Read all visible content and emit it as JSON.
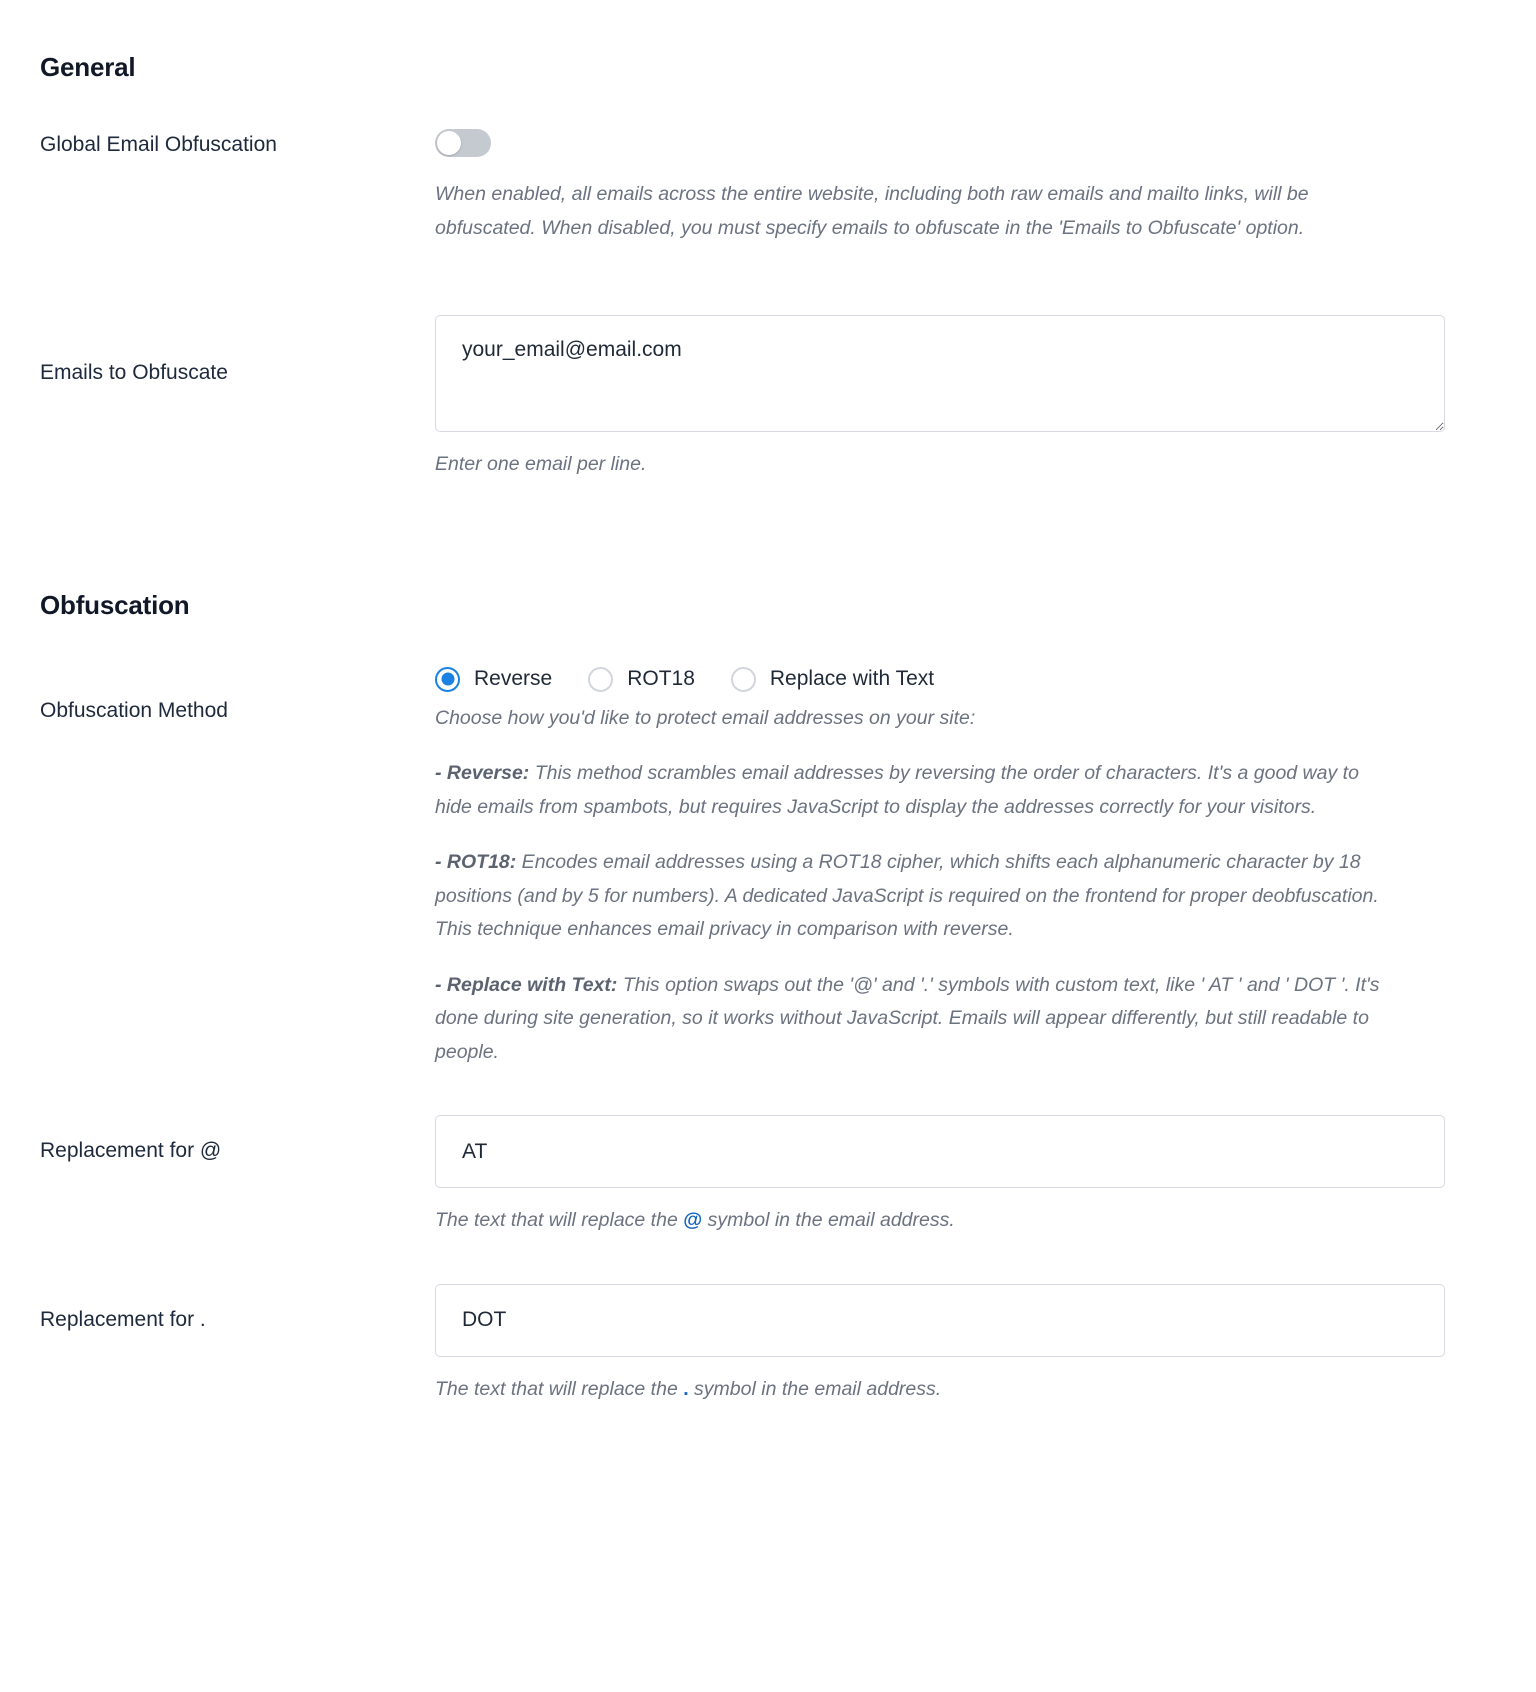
{
  "sections": {
    "general": {
      "heading": "General",
      "global_toggle": {
        "label": "Global Email Obfuscation",
        "state": "off",
        "description": "When enabled, all emails across the entire website, including both raw emails and mailto links, will be obfuscated. When disabled, you must specify emails to obfuscate in the 'Emails to Obfuscate' option."
      },
      "emails_to_obfuscate": {
        "label": "Emails to Obfuscate",
        "value": "your_email@email.com",
        "placeholder": "",
        "help": "Enter one email per line."
      }
    },
    "obfuscation": {
      "heading": "Obfuscation",
      "method": {
        "label": "Obfuscation Method",
        "selected": "Reverse",
        "options": [
          {
            "label": "Reverse",
            "selected": true
          },
          {
            "label": "ROT18",
            "selected": false
          },
          {
            "label": "Replace with Text",
            "selected": false
          }
        ],
        "intro": "Choose how you'd like to protect email addresses on your site:",
        "details": [
          {
            "term": "- Reverse:",
            "text": " This method scrambles email addresses by reversing the order of characters. It's a good way to hide emails from spambots, but requires JavaScript to display the addresses correctly for your visitors."
          },
          {
            "term": "- ROT18:",
            "text": " Encodes email addresses using a ROT18 cipher, which shifts each alphanumeric character by 18 positions (and by 5 for numbers). A dedicated JavaScript is required on the frontend for proper deobfuscation. This technique enhances email privacy in comparison with reverse."
          },
          {
            "term": "- Replace with Text:",
            "text": " This option swaps out the '@' and '.' symbols with custom text, like ' AT ' and ' DOT '. It's done during site generation, so it works without JavaScript. Emails will appear differently, but still readable to people."
          }
        ]
      },
      "replacement_at": {
        "label": "Replacement for @",
        "value": "AT",
        "placeholder": "",
        "help_before": "The text that will replace the ",
        "help_symbol": "@",
        "help_after": " symbol in the email address."
      },
      "replacement_dot": {
        "label": "Replacement for .",
        "value": "DOT",
        "placeholder": "",
        "help_before": "The text that will replace the ",
        "help_symbol": ".",
        "help_after": " symbol in the email address."
      }
    }
  },
  "colors": {
    "accent": "#1a82e2",
    "heading": "#111827",
    "label": "#1e293b",
    "muted": "#6b7280",
    "border": "#d7dae0",
    "toggle_off": "#c5c9d0",
    "code": "#1565c0"
  }
}
